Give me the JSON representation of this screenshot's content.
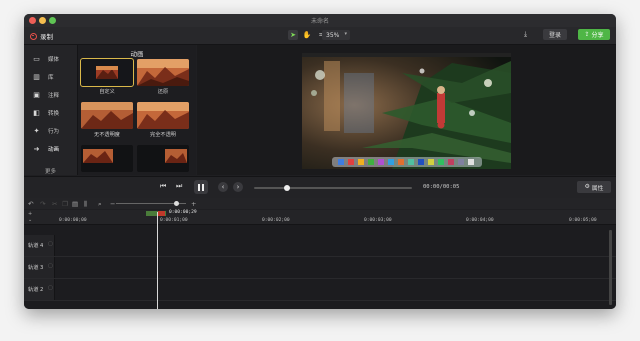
{
  "window": {
    "title": "未命名"
  },
  "toolbar": {
    "record_label": "录制",
    "zoom_value": "35%",
    "login_label": "登录",
    "share_label": "分享"
  },
  "sidebar": {
    "items": [
      {
        "label": "媒体",
        "icon": "film-icon"
      },
      {
        "label": "库",
        "icon": "library-icon"
      },
      {
        "label": "注释",
        "icon": "annotation-icon"
      },
      {
        "label": "转换",
        "icon": "transition-icon"
      },
      {
        "label": "行为",
        "icon": "behavior-icon"
      },
      {
        "label": "动画",
        "icon": "animation-icon"
      }
    ],
    "more_label": "更多"
  },
  "panel": {
    "title": "动画",
    "thumbs": [
      {
        "label": "自定义",
        "selected": true
      },
      {
        "label": "还原",
        "selected": false
      },
      {
        "label": "无不透明度",
        "selected": false
      },
      {
        "label": "完全不透明",
        "selected": false
      },
      {
        "label": "",
        "selected": false
      },
      {
        "label": "",
        "selected": false
      }
    ]
  },
  "player": {
    "timecode": "00:00/00:05",
    "progress_fraction": 0.19,
    "properties_label": "属性"
  },
  "timeline": {
    "playhead_label": "0:00:00;29",
    "ticks": [
      "0:00:00;00",
      "0:00:01;00",
      "0:00:02;00",
      "0:00:03;00",
      "0:00:04;00",
      "0:00:05;00"
    ],
    "tracks": [
      {
        "name": "轨道 4"
      },
      {
        "name": "轨道 3"
      },
      {
        "name": "轨道 2"
      }
    ]
  },
  "colors": {
    "accent_green": "#4fb646",
    "record_red": "#e8504a",
    "selection_gold": "#d9b84a"
  }
}
